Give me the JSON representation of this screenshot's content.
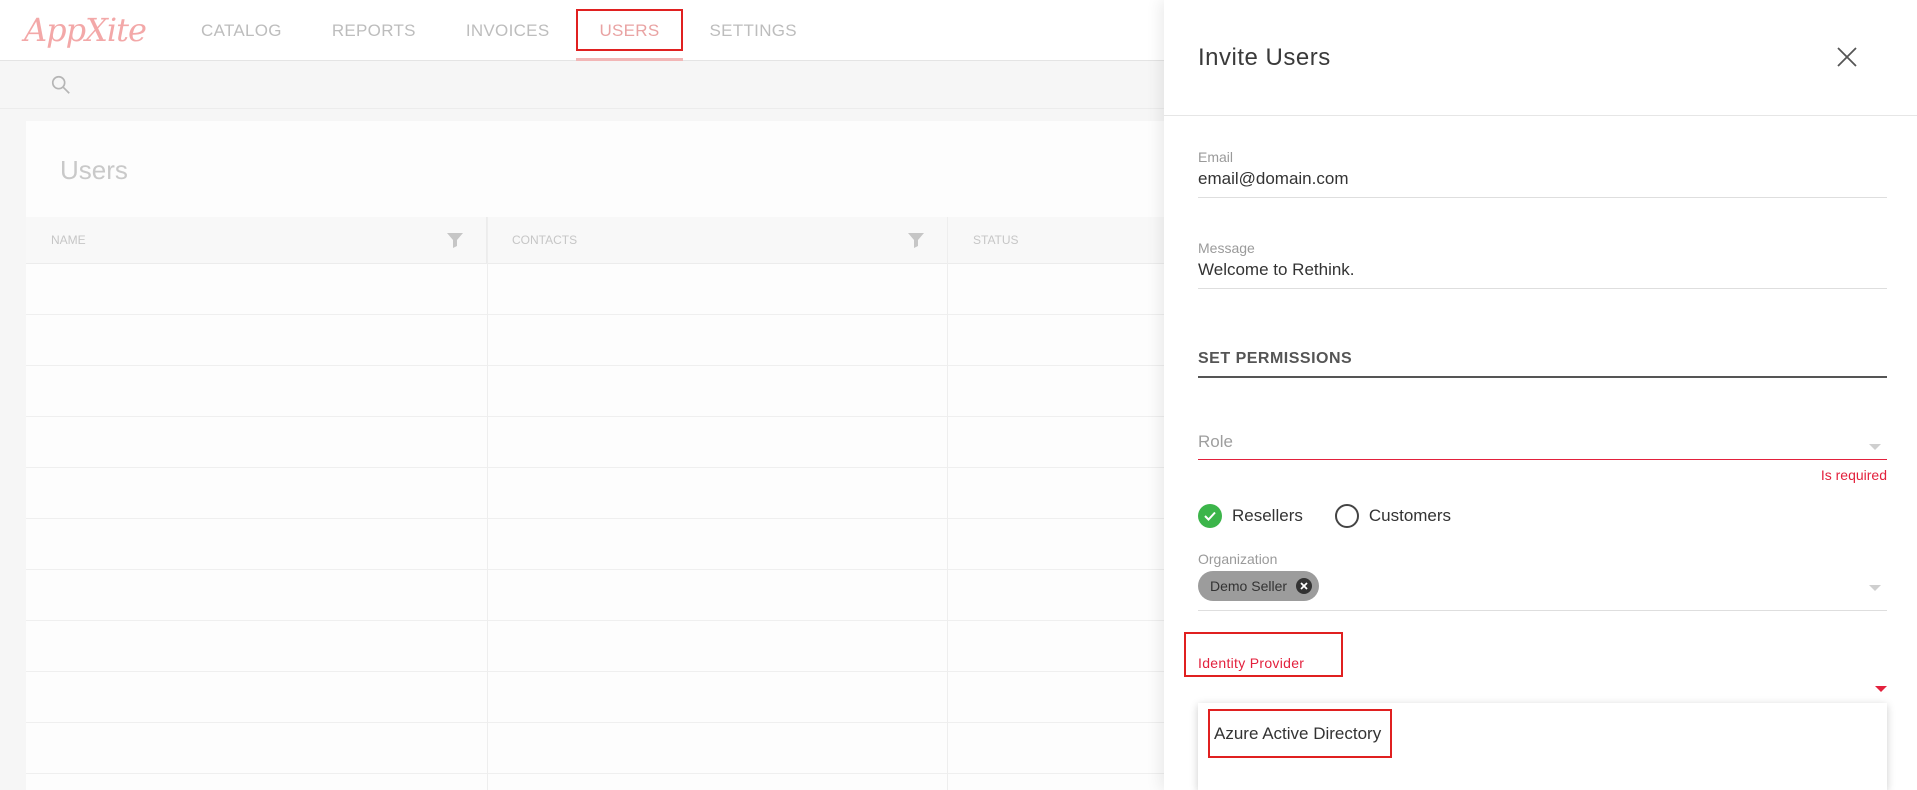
{
  "app": {
    "logo_text": "AppXite"
  },
  "nav": {
    "items": [
      "CATALOG",
      "REPORTS",
      "INVOICES",
      "USERS",
      "SETTINGS"
    ],
    "active": "USERS"
  },
  "users_page": {
    "title": "Users",
    "columns": [
      "NAME",
      "CONTACTS",
      "STATUS"
    ]
  },
  "invite_panel": {
    "title": "Invite Users",
    "email": {
      "label": "Email",
      "value": "email@domain.com"
    },
    "message": {
      "label": "Message",
      "value": "Welcome to Rethink."
    },
    "permissions_title": "SET PERMISSIONS",
    "role": {
      "placeholder": "Role",
      "error": "Is required"
    },
    "scope": {
      "options": [
        "Resellers",
        "Customers"
      ],
      "selected": "Resellers"
    },
    "organization": {
      "label": "Organization",
      "chips": [
        "Demo Seller"
      ]
    },
    "identity_provider": {
      "label": "Identity Provider",
      "options": [
        "Azure Active Directory"
      ]
    }
  },
  "colors": {
    "accent": "#e3213d",
    "success": "#3cb54a",
    "highlight": "#e02020"
  }
}
